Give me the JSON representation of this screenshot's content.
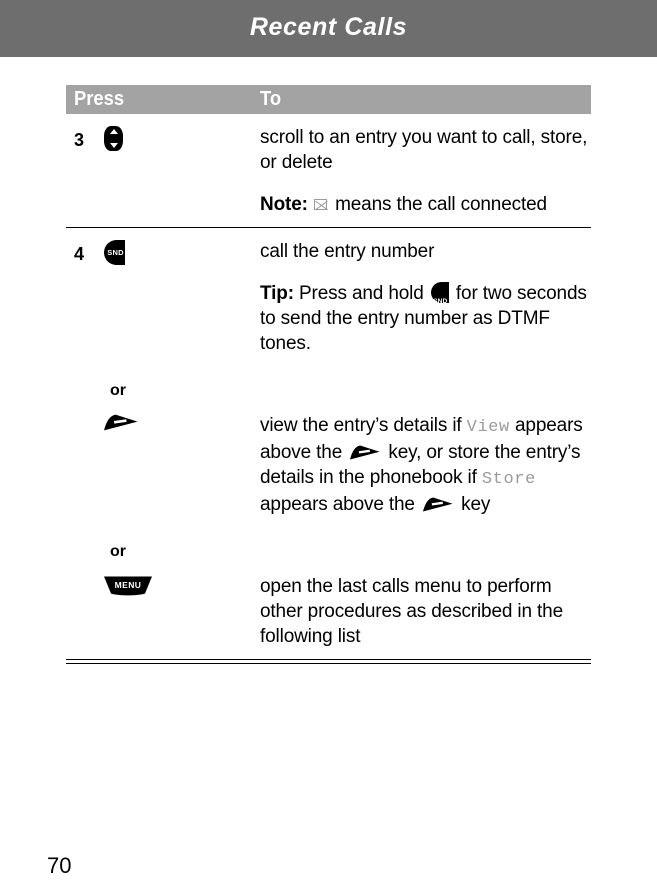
{
  "page": {
    "chapter_title": "Recent Calls",
    "page_number": "70",
    "header_bg": "#6e6e6e",
    "table_header_bg": "#a3a3a3",
    "display_term_color": "#9b9b9b"
  },
  "table": {
    "headers": {
      "press": "Press",
      "to": "To"
    },
    "rows": [
      {
        "step": "3",
        "key_icon": "navigation-key-icon",
        "paragraphs": [
          {
            "text": "scroll to an entry you want to call, store, or delete"
          },
          {
            "lead": "Note:",
            "text_before_icon": " ",
            "icon": "mail-envelope-icon",
            "text_after_icon": " means the call connected"
          }
        ]
      },
      {
        "step": "4",
        "key_icon": "snd-key-icon",
        "paragraphs": [
          {
            "text": "call the entry number"
          },
          {
            "lead": "Tip:",
            "text_before_icon": " Press and hold ",
            "icon": "snd-key-icon",
            "text_after_icon": " for two seconds to send the entry number as DTMF tones."
          }
        ],
        "alternatives": [
          {
            "or_label": "or",
            "key_icon": "soft-key-icon",
            "segments": [
              {
                "type": "text",
                "value": "view the entry’s details if "
              },
              {
                "type": "display",
                "value": "View"
              },
              {
                "type": "text",
                "value": " appears above the "
              },
              {
                "type": "icon",
                "value": "soft-key-icon"
              },
              {
                "type": "text",
                "value": " key, or store the entry’s details in the phonebook if "
              },
              {
                "type": "display",
                "value": "Store"
              },
              {
                "type": "text",
                "value": " appears above the "
              },
              {
                "type": "icon",
                "value": "soft-key-icon"
              },
              {
                "type": "text",
                "value": " key"
              }
            ]
          },
          {
            "or_label": "or",
            "key_icon": "menu-key-icon",
            "key_label": "MENU",
            "segments": [
              {
                "type": "text",
                "value": "open the last calls menu to perform other procedures as described in the following list"
              }
            ]
          }
        ]
      }
    ]
  }
}
